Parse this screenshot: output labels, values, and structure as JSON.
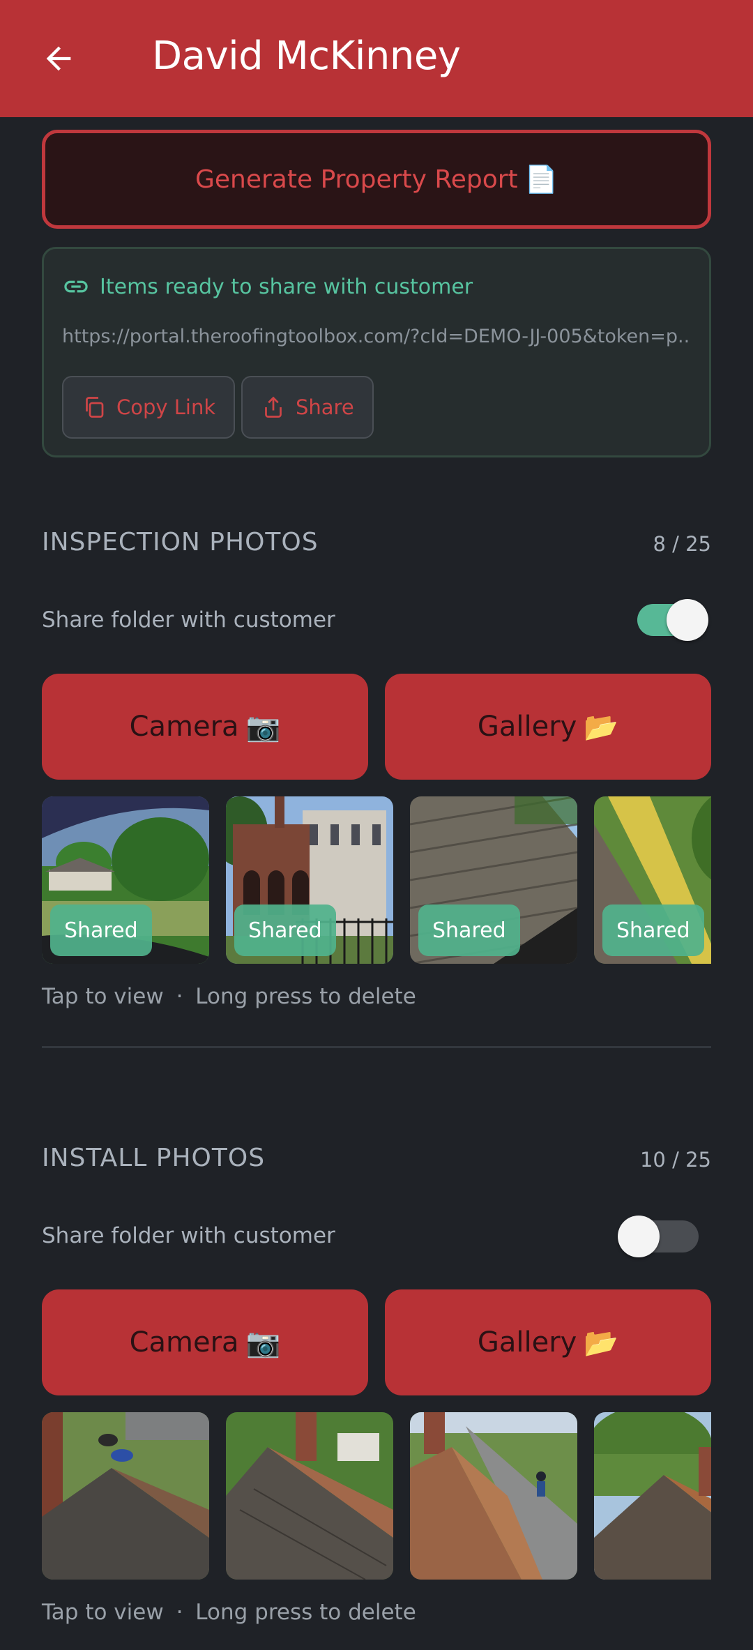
{
  "header": {
    "title": "David McKinney"
  },
  "report_button": {
    "label": "Generate Property Report",
    "emoji": "📄"
  },
  "share_card": {
    "heading": "Items ready to share with customer",
    "url": "https://portal.theroofingtoolbox.com/?cId=DEMO-JJ-005&token=p...",
    "copy_label": "Copy Link",
    "share_label": "Share"
  },
  "inspection": {
    "title": "INSPECTION PHOTOS",
    "count": "8 / 25",
    "toggle_label": "Share folder with customer",
    "share_enabled": true,
    "camera_label": "Camera",
    "camera_emoji": "📷",
    "gallery_label": "Gallery",
    "gallery_emoji": "📂",
    "badge": "Shared",
    "hint_tap": "Tap to view",
    "hint_sep": "·",
    "hint_long": "Long press to delete"
  },
  "install": {
    "title": "INSTALL PHOTOS",
    "count": "10 / 25",
    "toggle_label": "Share folder with customer",
    "share_enabled": false,
    "camera_label": "Camera",
    "camera_emoji": "📷",
    "gallery_label": "Gallery",
    "gallery_emoji": "📂",
    "hint_tap": "Tap to view",
    "hint_sep": "·",
    "hint_long": "Long press to delete"
  },
  "colors": {
    "appbar": "#b83236",
    "background": "#1f2227",
    "accent_green": "#57c4a0",
    "button_red": "#b83236"
  }
}
